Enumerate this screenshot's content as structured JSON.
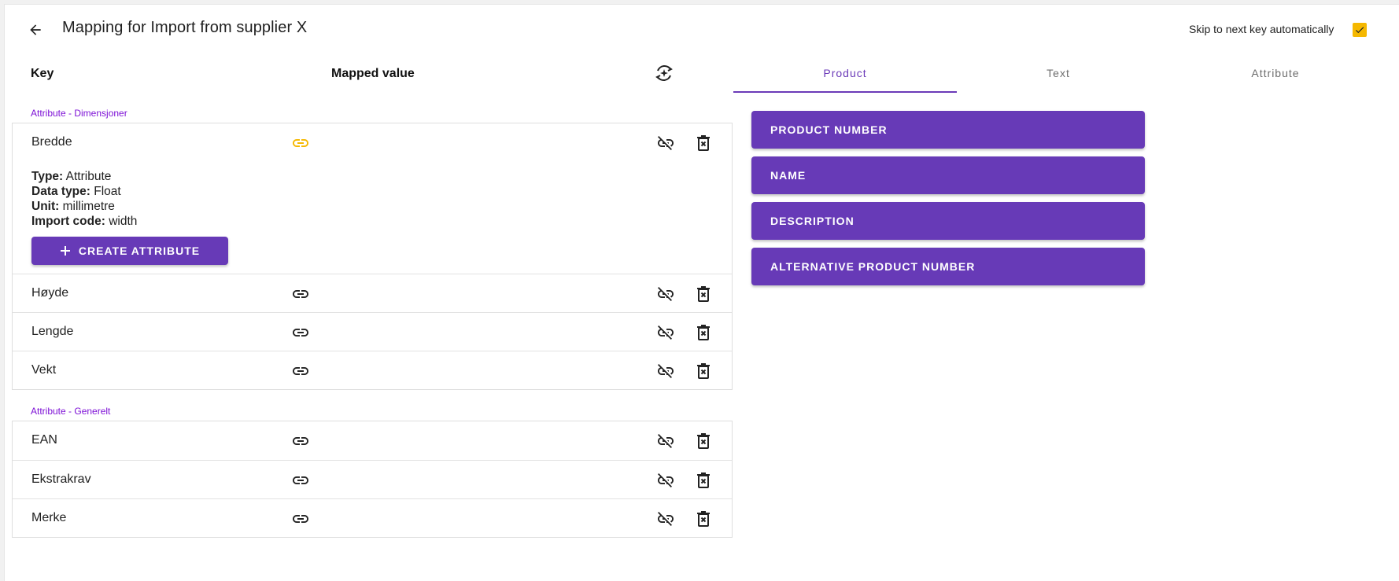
{
  "header": {
    "title": "Mapping for Import from supplier X",
    "skip_label": "Skip to next key automatically",
    "skip_checked": true
  },
  "columns": {
    "key": "Key",
    "mapped_value": "Mapped value"
  },
  "tabs": [
    {
      "label": "Product",
      "active": true
    },
    {
      "label": "Text",
      "active": false
    },
    {
      "label": "Attribute",
      "active": false
    }
  ],
  "groups": [
    {
      "label": "Attribute - Dimensjoner",
      "rows": [
        {
          "key": "Bredde",
          "expanded": true,
          "details": {
            "type_label": "Type:",
            "type_value": "Attribute",
            "datatype_label": "Data type:",
            "datatype_value": "Float",
            "unit_label": "Unit:",
            "unit_value": "millimetre",
            "importcode_label": "Import code:",
            "importcode_value": "width"
          },
          "create_button": "CREATE ATTRIBUTE"
        },
        {
          "key": "Høyde"
        },
        {
          "key": "Lengde"
        },
        {
          "key": "Vekt"
        }
      ]
    },
    {
      "label": "Attribute - Generelt",
      "rows": [
        {
          "key": "EAN"
        },
        {
          "key": "Ekstrakrav"
        },
        {
          "key": "Merke"
        }
      ]
    }
  ],
  "product_fields": [
    "PRODUCT NUMBER",
    "NAME",
    "DESCRIPTION",
    "ALTERNATIVE PRODUCT NUMBER"
  ],
  "colors": {
    "accent": "#673ab7",
    "link_active": "#f5b800",
    "group_label": "#7d10d6",
    "checkbox": "#f5b800"
  }
}
